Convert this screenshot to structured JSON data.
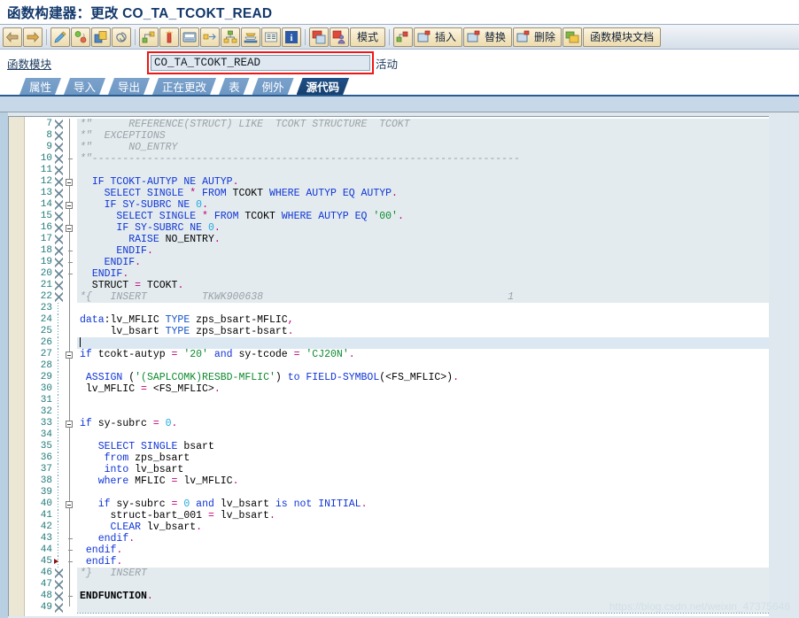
{
  "window": {
    "title": "函数构建器：更改 CO_TA_TCOKT_READ"
  },
  "toolbar": {
    "buttons": [
      {
        "name": "back-button",
        "icon": "arrow-left-icon",
        "label": ""
      },
      {
        "name": "forward-button",
        "icon": "arrow-right-icon",
        "label": ""
      },
      {
        "name": "display-change-button",
        "icon": "pencil-icon",
        "label": ""
      },
      {
        "name": "check-button",
        "icon": "traffic-light-icon",
        "label": ""
      },
      {
        "name": "copy-button",
        "icon": "copy-icon",
        "label": ""
      },
      {
        "name": "activate-button",
        "icon": "spiral-icon",
        "label": ""
      },
      {
        "name": "pattern-button",
        "icon": "pattern-icon",
        "label": ""
      },
      {
        "name": "pretty-printer-button",
        "icon": "test-tube-icon",
        "label": ""
      },
      {
        "name": "display-object-button",
        "icon": "screen-icon",
        "label": ""
      },
      {
        "name": "where-used-button",
        "icon": "arrows-split-icon",
        "label": ""
      },
      {
        "name": "hierarchy-button",
        "icon": "hierarchy-icon",
        "label": ""
      },
      {
        "name": "stack-button",
        "icon": "stack-icon",
        "label": ""
      },
      {
        "name": "list-button",
        "icon": "list-icon",
        "label": ""
      },
      {
        "name": "info-button",
        "icon": "info-icon",
        "label": ""
      }
    ],
    "buttons2": [
      {
        "name": "debug-button",
        "icon": "debug-icon",
        "label": ""
      },
      {
        "name": "debug-user-button",
        "icon": "debug-user-icon",
        "label": ""
      }
    ],
    "mode_label": "模式",
    "buttons3": [
      {
        "name": "navigate-button",
        "icon": "navigate-icon",
        "label": ""
      }
    ],
    "insert_label": "插入",
    "replace_label": "替换",
    "delete_label": "删除",
    "doc_button_icon": "doc-window-icon",
    "doc_label": "函数模块文档"
  },
  "function_module": {
    "label": "函数模块",
    "value": "CO_TA_TCOKT_READ",
    "placeholder": "",
    "status": "活动"
  },
  "tabs": [
    {
      "label": "属性",
      "name": "tab-attributes",
      "active": false
    },
    {
      "label": "导入",
      "name": "tab-import",
      "active": false
    },
    {
      "label": "导出",
      "name": "tab-export",
      "active": false
    },
    {
      "label": "正在更改",
      "name": "tab-changing",
      "active": false
    },
    {
      "label": "表",
      "name": "tab-tables",
      "active": false
    },
    {
      "label": "例外",
      "name": "tab-exceptions",
      "active": false
    },
    {
      "label": "源代码",
      "name": "tab-source-code",
      "active": true
    }
  ],
  "editor": {
    "first_line": 7,
    "watermark": "https://blog.csdn.net/weixin_47375646",
    "lines": [
      {
        "n": 7,
        "readonly": true,
        "hatched": true,
        "fold": "",
        "html": "<span class='cmt'>*\"      REFERENCE(STRUCT) LIKE  TCOKT STRUCTURE  TCOKT</span>"
      },
      {
        "n": 8,
        "readonly": true,
        "hatched": true,
        "fold": "",
        "html": "<span class='cmt'>*\"  EXCEPTIONS</span>"
      },
      {
        "n": 9,
        "readonly": true,
        "hatched": true,
        "fold": "",
        "html": "<span class='cmt'>*\"      NO_ENTRY</span>"
      },
      {
        "n": 10,
        "readonly": true,
        "hatched": true,
        "fold": "tick",
        "html": "<span class='cmt'>*\"----------------------------------------------------------------------</span>"
      },
      {
        "n": 11,
        "readonly": true,
        "hatched": true,
        "fold": "",
        "html": ""
      },
      {
        "n": 12,
        "readonly": true,
        "hatched": true,
        "fold": "box",
        "html": "  <span class='kw'>IF</span> <span class='kw'>TCOKT-AUTYP</span> <span class='kw'>NE</span> <span class='kw'>AUTYP</span><span class='punc'>.</span>"
      },
      {
        "n": 13,
        "readonly": true,
        "hatched": true,
        "fold": "",
        "html": "    <span class='kw'>SELECT SINGLE</span> <span class='punc'>*</span> <span class='kw'>FROM</span> TCOKT <span class='kw'>WHERE</span> <span class='kw'>AUTYP</span> <span class='kw'>EQ</span> <span class='kw'>AUTYP</span><span class='punc'>.</span>"
      },
      {
        "n": 14,
        "readonly": true,
        "hatched": true,
        "fold": "box",
        "html": "    <span class='kw'>IF</span> <span class='kw'>SY-SUBRC</span> <span class='kw'>NE</span> <span class='num'>0</span><span class='punc'>.</span>"
      },
      {
        "n": 15,
        "readonly": true,
        "hatched": true,
        "fold": "",
        "html": "      <span class='kw'>SELECT SINGLE</span> <span class='punc'>*</span> <span class='kw'>FROM</span> TCOKT <span class='kw'>WHERE</span> <span class='kw'>AUTYP</span> <span class='kw'>EQ</span> <span class='str'>'00'</span><span class='punc'>.</span>"
      },
      {
        "n": 16,
        "readonly": true,
        "hatched": true,
        "fold": "box",
        "html": "      <span class='kw'>IF</span> <span class='kw'>SY-SUBRC</span> <span class='kw'>NE</span> <span class='num'>0</span><span class='punc'>.</span>"
      },
      {
        "n": 17,
        "readonly": true,
        "hatched": true,
        "fold": "",
        "html": "        <span class='kw'>RAISE</span> NO_ENTRY<span class='punc'>.</span>"
      },
      {
        "n": 18,
        "readonly": true,
        "hatched": true,
        "fold": "tick",
        "html": "      <span class='kw'>ENDIF</span><span class='punc'>.</span>"
      },
      {
        "n": 19,
        "readonly": true,
        "hatched": true,
        "fold": "tick",
        "html": "    <span class='kw'>ENDIF</span><span class='punc'>.</span>"
      },
      {
        "n": 20,
        "readonly": true,
        "hatched": true,
        "fold": "tick",
        "html": "  <span class='kw'>ENDIF</span><span class='punc'>.</span>"
      },
      {
        "n": 21,
        "readonly": true,
        "hatched": true,
        "fold": "",
        "html": "  STRUCT <span class='op'>=</span> TCOKT<span class='punc'>.</span>"
      },
      {
        "n": 22,
        "readonly": true,
        "hatched": true,
        "fold": "",
        "html": "<span class='cmt'>*{   INSERT         TKWK900638                                        1</span>"
      },
      {
        "n": 23,
        "readonly": false,
        "hatched": false,
        "fold": "",
        "html": ""
      },
      {
        "n": 24,
        "readonly": false,
        "hatched": false,
        "fold": "",
        "html": "<span class='kw'>data</span>:lv_MFLIC <span class='kw2'>TYPE</span> zps_bsart-MFLIC<span class='punc'>,</span>"
      },
      {
        "n": 25,
        "readonly": false,
        "hatched": false,
        "fold": "",
        "html": "     lv_bsart <span class='kw2'>TYPE</span> zps_bsart-bsart<span class='punc'>.</span>"
      },
      {
        "n": 26,
        "readonly": false,
        "hatched": false,
        "fold": "",
        "current": true,
        "html": "<span class='caret'></span>"
      },
      {
        "n": 27,
        "readonly": false,
        "hatched": false,
        "fold": "box",
        "html": "<span class='kw'>if</span> tcokt-autyp <span class='op'>=</span> <span class='str'>'20'</span> <span class='kw'>and</span> sy-tcode <span class='op'>=</span> <span class='str'>'CJ20N'</span><span class='punc'>.</span>"
      },
      {
        "n": 28,
        "readonly": false,
        "hatched": false,
        "fold": "",
        "html": ""
      },
      {
        "n": 29,
        "readonly": false,
        "hatched": false,
        "fold": "",
        "html": " <span class='kw'>ASSIGN</span> (<span class='str'>'(SAPLCOMK)RESBD-MFLIC'</span>) <span class='kw'>to</span> <span class='kw'>FIELD-SYMBOL</span>(&lt;FS_MFLIC&gt;)<span class='punc'>.</span>"
      },
      {
        "n": 30,
        "readonly": false,
        "hatched": false,
        "fold": "",
        "html": " lv_MFLIC <span class='op'>=</span> &lt;FS_MFLIC&gt;<span class='punc'>.</span>"
      },
      {
        "n": 31,
        "readonly": false,
        "hatched": false,
        "fold": "",
        "html": ""
      },
      {
        "n": 32,
        "readonly": false,
        "hatched": false,
        "fold": "",
        "html": ""
      },
      {
        "n": 33,
        "readonly": false,
        "hatched": false,
        "fold": "box",
        "html": "<span class='kw'>if</span> sy-subrc <span class='op'>=</span> <span class='num'>0</span><span class='punc'>.</span>"
      },
      {
        "n": 34,
        "readonly": false,
        "hatched": false,
        "fold": "",
        "html": ""
      },
      {
        "n": 35,
        "readonly": false,
        "hatched": false,
        "fold": "",
        "html": "   <span class='kw'>SELECT SINGLE</span> bsart"
      },
      {
        "n": 36,
        "readonly": false,
        "hatched": false,
        "fold": "",
        "html": "    <span class='kw'>from</span> zps_bsart"
      },
      {
        "n": 37,
        "readonly": false,
        "hatched": false,
        "fold": "",
        "html": "    <span class='kw'>into</span> lv_bsart"
      },
      {
        "n": 38,
        "readonly": false,
        "hatched": false,
        "fold": "",
        "html": "   <span class='kw'>where</span> MFLIC <span class='op'>=</span> lv_MFLIC<span class='punc'>.</span>"
      },
      {
        "n": 39,
        "readonly": false,
        "hatched": false,
        "fold": "",
        "html": ""
      },
      {
        "n": 40,
        "readonly": false,
        "hatched": false,
        "fold": "box",
        "html": "   <span class='kw'>if</span> sy-subrc <span class='op'>=</span> <span class='num'>0</span> <span class='kw'>and</span> lv_bsart <span class='kw'>is</span> <span class='kw'>not</span> <span class='kw'>INITIAL</span><span class='punc'>.</span>"
      },
      {
        "n": 41,
        "readonly": false,
        "hatched": false,
        "fold": "",
        "html": "     struct-bart_001 <span class='op'>=</span> lv_bsart<span class='punc'>.</span>"
      },
      {
        "n": 42,
        "readonly": false,
        "hatched": false,
        "fold": "",
        "html": "     <span class='kw'>CLEAR</span> lv_bsart<span class='punc'>.</span>"
      },
      {
        "n": 43,
        "readonly": false,
        "hatched": false,
        "fold": "tick",
        "html": "   <span class='kw'>endif</span><span class='punc'>.</span>"
      },
      {
        "n": 44,
        "readonly": false,
        "hatched": false,
        "fold": "tick",
        "html": " <span class='kw'>endif</span><span class='punc'>.</span>"
      },
      {
        "n": 45,
        "readonly": false,
        "hatched": false,
        "fold": "tick",
        "arrow": true,
        "html": " <span class='kw'>endif</span><span class='punc'>.</span>"
      },
      {
        "n": 46,
        "readonly": true,
        "hatched": true,
        "fold": "",
        "html": "<span class='cmt'>*}   INSERT</span>"
      },
      {
        "n": 47,
        "readonly": true,
        "hatched": true,
        "fold": "",
        "html": ""
      },
      {
        "n": 48,
        "readonly": true,
        "hatched": true,
        "fold": "tick",
        "html": "<span class='bld'>ENDFUNCTION</span><span class='punc'>.</span>"
      },
      {
        "n": 49,
        "readonly": true,
        "hatched": true,
        "fold": "",
        "html": ""
      }
    ]
  }
}
